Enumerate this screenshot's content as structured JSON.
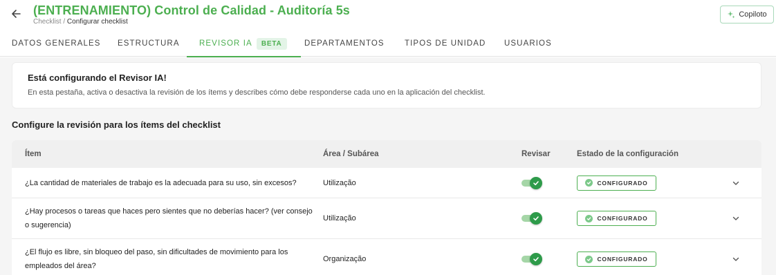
{
  "header": {
    "title": "(ENTRENAMIENTO) Control de Calidad - Auditoría 5s",
    "breadcrumb_root": "Checklist",
    "breadcrumb_separator": "/",
    "breadcrumb_current": "Configurar checklist",
    "copilot_label": "Copiloto",
    "accent_color": "#4caf50"
  },
  "tabs": [
    {
      "label": "DATOS GENERALES"
    },
    {
      "label": "ESTRUCTURA"
    },
    {
      "label": "REVISOR IA",
      "badge": "BETA",
      "active": true
    },
    {
      "label": "DEPARTAMENTOS"
    },
    {
      "label": "TIPOS DE UNIDAD"
    },
    {
      "label": "USUARIOS"
    }
  ],
  "info": {
    "title": "Está configurando el Revisor IA!",
    "text": "En esta pestaña, activa o desactiva la revisión de los ítems y describes cómo debe responderse cada uno en la aplicación del checklist."
  },
  "section_title": "Configure la revisión para los ítems del checklist",
  "table": {
    "columns": {
      "item": "Ítem",
      "area": "Área / Subárea",
      "review": "Revisar",
      "status": "Estado de la configuración"
    },
    "rows": [
      {
        "item": "¿La cantidad de materiales de trabajo es la adecuada para su uso, sin excesos?",
        "area": "Utilização",
        "review": true,
        "status": "CONFIGURADO"
      },
      {
        "item": "¿Hay procesos o tareas que haces pero sientes que no deberías hacer? (ver consejo o sugerencia)",
        "area": "Utilização",
        "review": true,
        "status": "CONFIGURADO"
      },
      {
        "item": "¿El flujo es libre, sin bloqueo del paso, sin dificultades de movimiento para los empleados del área?",
        "area": "Organização",
        "review": true,
        "status": "CONFIGURADO"
      }
    ]
  },
  "icons": {
    "back": "arrow-left-icon",
    "copilot": "sparkle-icon",
    "check": "check-icon",
    "expand": "chevron-down-icon"
  }
}
